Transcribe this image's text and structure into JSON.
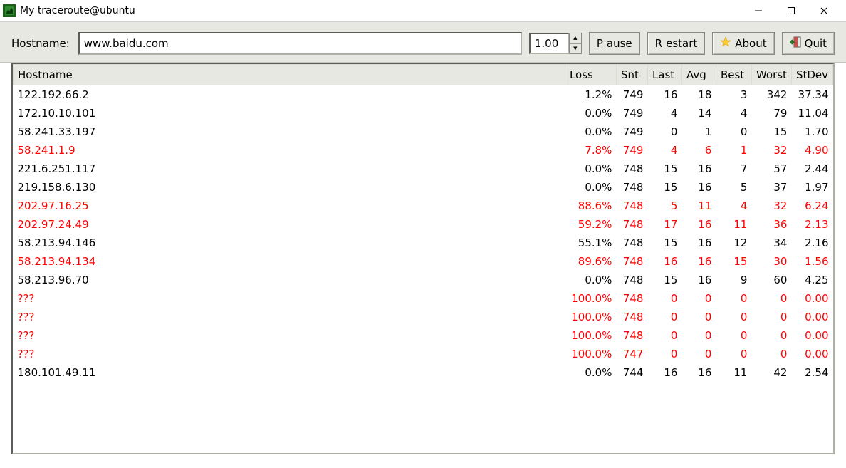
{
  "window": {
    "title": "My traceroute@ubuntu"
  },
  "toolbar": {
    "hostname_label_prefix": "H",
    "hostname_label_rest": "ostname:",
    "hostname_value": "www.baidu.com",
    "interval_value": "1.00",
    "pause_prefix": "P",
    "pause_rest": "ause",
    "restart_prefix": "R",
    "restart_rest": "estart",
    "about_prefix": "A",
    "about_rest": "bout",
    "quit_prefix": "Q",
    "quit_rest": "uit"
  },
  "columns": {
    "hostname": "Hostname",
    "loss": "Loss",
    "snt": "Snt",
    "last": "Last",
    "avg": "Avg",
    "best": "Best",
    "worst": "Worst",
    "stdev": "StDev"
  },
  "rows": [
    {
      "host": "122.192.66.2",
      "loss": "1.2%",
      "snt": "749",
      "last": "16",
      "avg": "18",
      "best": "3",
      "worst": "342",
      "stdev": "37.34",
      "red": false
    },
    {
      "host": "172.10.10.101",
      "loss": "0.0%",
      "snt": "749",
      "last": "4",
      "avg": "14",
      "best": "4",
      "worst": "79",
      "stdev": "11.04",
      "red": false
    },
    {
      "host": "58.241.33.197",
      "loss": "0.0%",
      "snt": "749",
      "last": "0",
      "avg": "1",
      "best": "0",
      "worst": "15",
      "stdev": "1.70",
      "red": false
    },
    {
      "host": "58.241.1.9",
      "loss": "7.8%",
      "snt": "749",
      "last": "4",
      "avg": "6",
      "best": "1",
      "worst": "32",
      "stdev": "4.90",
      "red": true
    },
    {
      "host": "221.6.251.117",
      "loss": "0.0%",
      "snt": "748",
      "last": "15",
      "avg": "16",
      "best": "7",
      "worst": "57",
      "stdev": "2.44",
      "red": false
    },
    {
      "host": "219.158.6.130",
      "loss": "0.0%",
      "snt": "748",
      "last": "15",
      "avg": "16",
      "best": "5",
      "worst": "37",
      "stdev": "1.97",
      "red": false
    },
    {
      "host": "202.97.16.25",
      "loss": "88.6%",
      "snt": "748",
      "last": "5",
      "avg": "11",
      "best": "4",
      "worst": "32",
      "stdev": "6.24",
      "red": true
    },
    {
      "host": "202.97.24.49",
      "loss": "59.2%",
      "snt": "748",
      "last": "17",
      "avg": "16",
      "best": "11",
      "worst": "36",
      "stdev": "2.13",
      "red": true
    },
    {
      "host": "58.213.94.146",
      "loss": "55.1%",
      "snt": "748",
      "last": "15",
      "avg": "16",
      "best": "12",
      "worst": "34",
      "stdev": "2.16",
      "red": false
    },
    {
      "host": "58.213.94.134",
      "loss": "89.6%",
      "snt": "748",
      "last": "16",
      "avg": "16",
      "best": "15",
      "worst": "30",
      "stdev": "1.56",
      "red": true
    },
    {
      "host": "58.213.96.70",
      "loss": "0.0%",
      "snt": "748",
      "last": "15",
      "avg": "16",
      "best": "9",
      "worst": "60",
      "stdev": "4.25",
      "red": false
    },
    {
      "host": "???",
      "loss": "100.0%",
      "snt": "748",
      "last": "0",
      "avg": "0",
      "best": "0",
      "worst": "0",
      "stdev": "0.00",
      "red": true
    },
    {
      "host": "???",
      "loss": "100.0%",
      "snt": "748",
      "last": "0",
      "avg": "0",
      "best": "0",
      "worst": "0",
      "stdev": "0.00",
      "red": true
    },
    {
      "host": "???",
      "loss": "100.0%",
      "snt": "748",
      "last": "0",
      "avg": "0",
      "best": "0",
      "worst": "0",
      "stdev": "0.00",
      "red": true
    },
    {
      "host": "???",
      "loss": "100.0%",
      "snt": "747",
      "last": "0",
      "avg": "0",
      "best": "0",
      "worst": "0",
      "stdev": "0.00",
      "red": true
    },
    {
      "host": "180.101.49.11",
      "loss": "0.0%",
      "snt": "744",
      "last": "16",
      "avg": "16",
      "best": "11",
      "worst": "42",
      "stdev": "2.54",
      "red": false
    }
  ]
}
